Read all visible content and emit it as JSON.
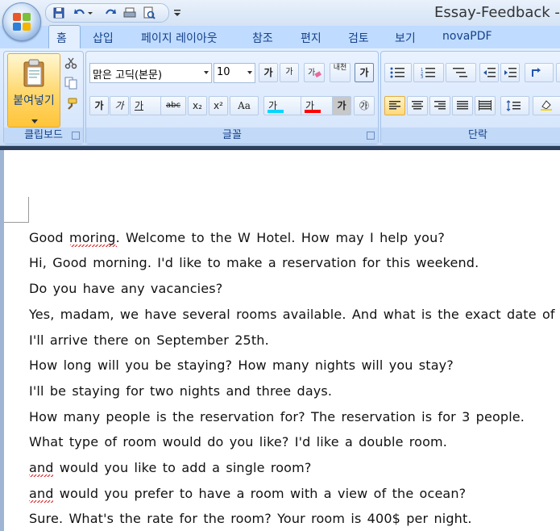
{
  "window": {
    "title": "Essay-Feedback -",
    "qat_icons": [
      "save-icon",
      "undo-icon",
      "redo-icon",
      "print-preview-icon"
    ]
  },
  "tabs": [
    {
      "label": "홈",
      "active": true
    },
    {
      "label": "삽입"
    },
    {
      "label": "페이지 레이아웃"
    },
    {
      "label": "참조"
    },
    {
      "label": "편지"
    },
    {
      "label": "검토"
    },
    {
      "label": "보기"
    },
    {
      "label": "novaPDF"
    }
  ],
  "ribbon": {
    "clipboard": {
      "label": "클립보드",
      "paste_label": "붙여넣기"
    },
    "font": {
      "label": "글꼴",
      "font_name": "맑은 고딕(본문)",
      "font_size": "10",
      "grow": "가",
      "shrink": "가",
      "bold": "가",
      "italic": "가",
      "underline": "가",
      "strike": "abc",
      "subscript": "x₂",
      "superscript": "x²",
      "change_case": "Aa",
      "highlight": "가",
      "font_color": "가",
      "char_shading": "가",
      "enclose": "㉮",
      "phonetic": "내천",
      "char_border": "가",
      "highlight_color": "#00d7ff",
      "font_color_value": "#ff0000"
    },
    "paragraph": {
      "label": "단락"
    }
  },
  "document": {
    "lines": [
      "Good moring. Welcome to the W Hotel. How may I help you?",
      "Hi, Good morning. I'd like to make a reservation for this weekend.",
      "Do you have any vacancies?",
      "Yes, madam, we have several rooms available. And what is the exact date of yo",
      "I'll arrive there on September 25th.",
      "How long will you be staying? How many nights will you stay?",
      "I'll be staying for two nights and three days.",
      "How many people is the reservation for? The reservation is for 3 people.",
      "What type of room would do you like? I'd like a double room.",
      "and would you like to add a single room?",
      "and would you prefer to have a room with a view of the ocean?",
      "Sure. What's the rate for the room? Your room is 400$ per night."
    ]
  }
}
